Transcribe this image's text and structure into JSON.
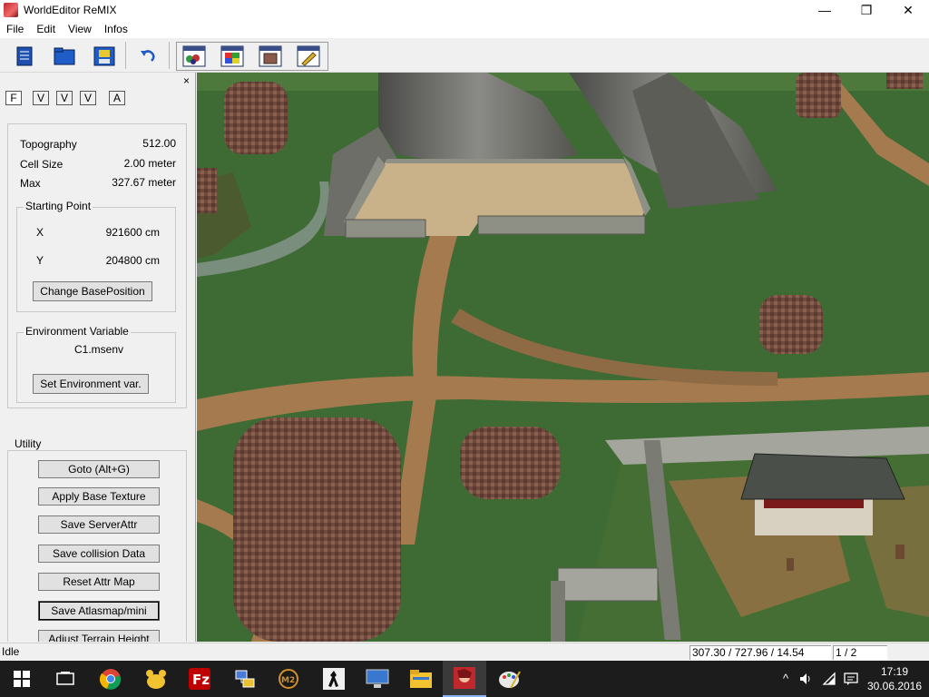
{
  "window": {
    "title": "WorldEditor ReMIX",
    "min_glyph": "—",
    "max_glyph": "❐",
    "close_glyph": "✕"
  },
  "menu": [
    "File",
    "Edit",
    "View",
    "Infos"
  ],
  "toolbar": {
    "icons": [
      "new-document-icon",
      "open-folder-icon",
      "save-disk-icon",
      "undo-icon",
      "terrain-tool-icon",
      "texture-tool-icon",
      "object-tool-icon",
      "brush-tool-icon"
    ]
  },
  "panel": {
    "close_glyph": "×",
    "tabs": [
      "F",
      "V",
      "V",
      "V",
      "A"
    ],
    "topography_label": "Topography",
    "topography_value": "512.00",
    "cellsize_label": "Cell Size",
    "cellsize_value": "2.00 meter",
    "max_label": "Max",
    "max_value": "327.67 meter",
    "starting_point_legend": "Starting Point",
    "x_label": "X",
    "x_value": "921600 cm",
    "y_label": "Y",
    "y_value": "204800 cm",
    "change_base_button": "Change BasePosition",
    "env_legend": "Environment Variable",
    "env_value": "C1.msenv",
    "set_env_button": "Set Environment var.",
    "utility_legend": "Utility",
    "utility_buttons": [
      "Goto (Alt+G)",
      "Apply Base Texture",
      "Save ServerAttr",
      "Save collision Data",
      "Reset Attr Map",
      "Save Atlasmap/mini",
      "Adjust Terrain Height"
    ]
  },
  "status": {
    "state": "Idle",
    "coords": "307.30 / 727.96 / 14.54",
    "page": "1 / 2"
  },
  "taskbar": {
    "apps": [
      "start-windows-icon",
      "task-view-icon",
      "chrome-icon",
      "paw-app-icon",
      "filezilla-icon",
      "network-app-icon",
      "game-launcher-icon",
      "counter-strike-icon",
      "remote-desktop-icon",
      "file-explorer-icon",
      "worldeditor-icon",
      "paint-icon"
    ],
    "time": "17:19",
    "date": "30.06.2016"
  },
  "colors": {
    "grass": "#3d6b33",
    "path": "#a57a4e",
    "wall": "#8e8f85",
    "tree": "#6f4a3c",
    "taskbar": "#1c1c1c"
  }
}
